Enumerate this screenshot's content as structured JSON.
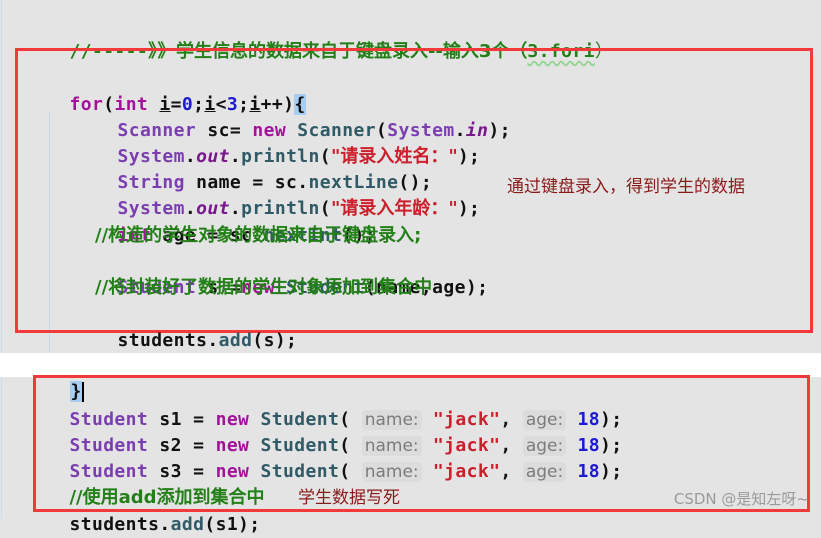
{
  "header_comment": {
    "prefix": "//-----》》",
    "text": "学生信息的数据来自于键盘录入--输入3个（",
    "hint": "3.fori",
    "suffix": "）"
  },
  "loop_block": {
    "for_kw": "for",
    "paren_open": "(",
    "int_kw": "int",
    "var_i": "i",
    "eq": "=",
    "zero": "0",
    "semi1": ";",
    "lt": "<",
    "three": "3",
    "semi2": ";",
    "inc": "++",
    "paren_close": ")",
    "brace_open": "{",
    "lines": {
      "scanner": {
        "type": "Scanner",
        "var": " sc= ",
        "new_kw": "new",
        "ctor": " Scanner",
        "lp": "(",
        "sys": "System",
        "dot": ".",
        "field": "in",
        "end": ");"
      },
      "print_name": {
        "sys": "System",
        "dot1": ".",
        "field": "out",
        "dot2": ".",
        "method": "println",
        "lp": "(",
        "str": "\"请录入姓名：\"",
        "end": ");"
      },
      "read_name": {
        "type": "String",
        "mid": " name = sc.",
        "method": "nextLine",
        "end": "();"
      },
      "print_age": {
        "sys": "System",
        "dot1": ".",
        "field": "out",
        "dot2": ".",
        "method": "println",
        "lp": "(",
        "str": "\"请录入年龄：\"",
        "end": ");"
      },
      "read_age": {
        "type": "int",
        "mid": " age = sc.",
        "method": "nextInt",
        "end": "();"
      },
      "comment1": "//构造的学生对象的数据来自于键盘录入;",
      "construct": {
        "type": "Student",
        "mid": " s =",
        "new_kw": "new",
        "ctor": " Student",
        "args": "(name,age);"
      },
      "comment2": "//将封装好了数据的学生对象添加到集合中",
      "add": {
        "obj": "students.",
        "method": "add",
        "args": "(s);"
      }
    },
    "brace_close": "}",
    "annotation": "通过键盘录入，得到学生的数据"
  },
  "hardcoded_block": {
    "students": [
      {
        "type": "Student",
        "var": " s1 = ",
        "new_kw": "new",
        "ctor": " Student",
        "lp": "(",
        "name_hint": "name:",
        "name_val": "\"jack\"",
        "comma": ", ",
        "age_hint": "age:",
        "age_val": "18",
        "end": ");"
      },
      {
        "type": "Student",
        "var": " s2 = ",
        "new_kw": "new",
        "ctor": " Student",
        "lp": "(",
        "name_hint": "name:",
        "name_val": "\"jack\"",
        "comma": ", ",
        "age_hint": "age:",
        "age_val": "18",
        "end": ");"
      },
      {
        "type": "Student",
        "var": " s3 = ",
        "new_kw": "new",
        "ctor": " Student",
        "lp": "(",
        "name_hint": "name:",
        "name_val": "\"jack\"",
        "comma": ", ",
        "age_hint": "age:",
        "age_val": "18",
        "end": ");"
      }
    ],
    "comment_prefix": "//使用",
    "comment_add": "add",
    "comment_suffix": "添加到集合中",
    "add": {
      "obj": "students.",
      "method": "add",
      "args": "(s1);"
    },
    "annotation": "学生数据写死"
  },
  "watermark": "CSDN @是知左呀~",
  "colors": {
    "background": "#e4e4e4",
    "box_border": "#f23a3a",
    "keyword": "#a2129a",
    "class": "#7a3eb0",
    "string": "#cc1f2c",
    "comment": "#237f17",
    "number": "#1b1ad1",
    "annotation": "#8b1a1a"
  }
}
